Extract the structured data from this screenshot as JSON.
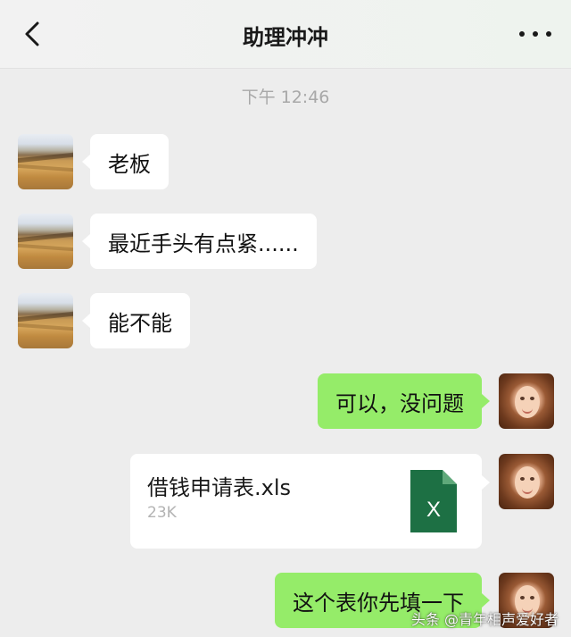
{
  "header": {
    "title": "助理冲冲"
  },
  "timestamp": "下午 12:46",
  "messages": [
    {
      "side": "left",
      "text": "老板"
    },
    {
      "side": "left",
      "text": "最近手头有点紧......"
    },
    {
      "side": "left",
      "text": "能不能"
    },
    {
      "side": "right",
      "text": "可以，没问题"
    },
    {
      "side": "right",
      "type": "file",
      "file_name": "借钱申请表.xls",
      "file_size": "23K",
      "file_icon_letter": "X"
    },
    {
      "side": "right",
      "text": "这个表你先填一下"
    }
  ],
  "watermark": "头条 @青年相声爱好者",
  "colors": {
    "background": "#ededed",
    "bubble_sent": "#95ec69",
    "bubble_received": "#ffffff",
    "excel_green": "#1d7044"
  },
  "icons": {
    "back": "chevron-left-icon",
    "more": "more-dots-icon",
    "file": "excel-file-icon"
  }
}
